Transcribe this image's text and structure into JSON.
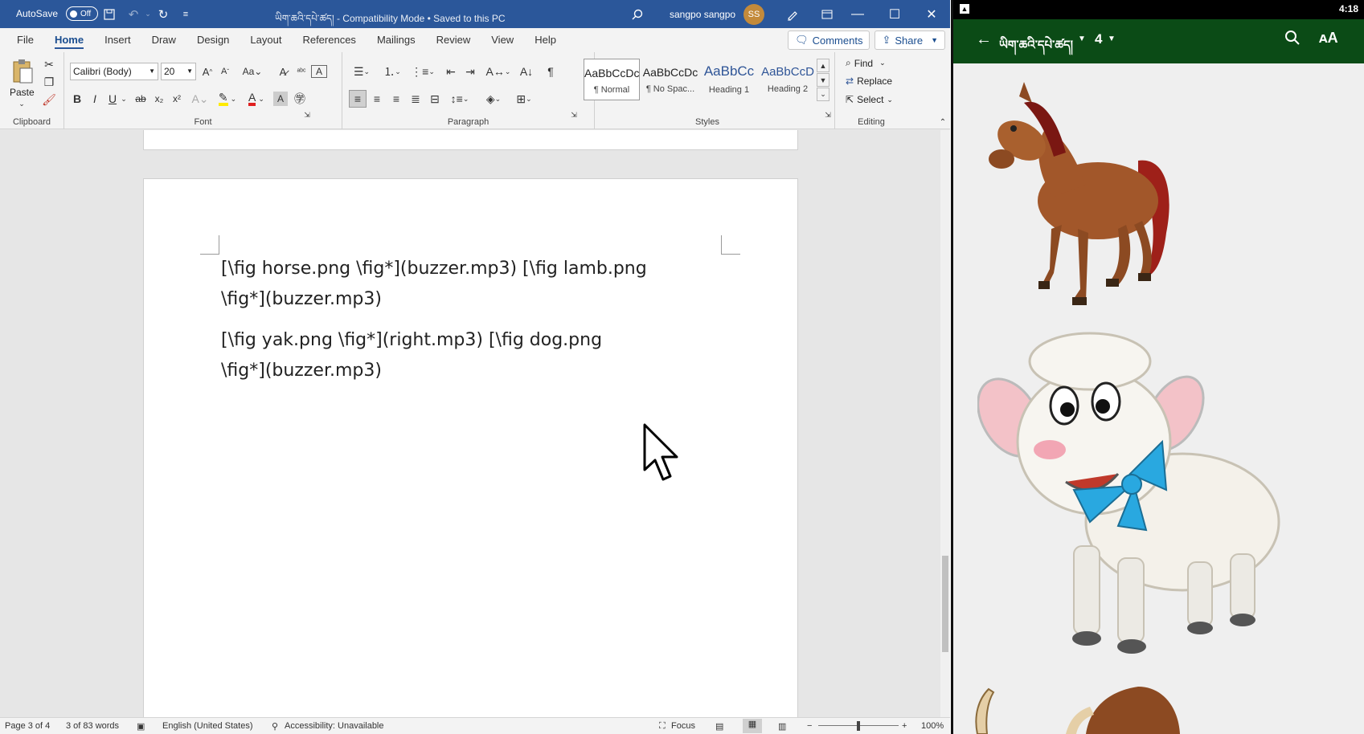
{
  "word": {
    "titlebar": {
      "autosave_label": "AutoSave",
      "autosave_state": "Off",
      "title": "ཡིག་ཆའི་དཔེ་ཚད། - Compatibility Mode • Saved to this PC",
      "user_name": "sangpo sangpo",
      "user_initials": "SS"
    },
    "tabs": [
      "File",
      "Home",
      "Insert",
      "Draw",
      "Design",
      "Layout",
      "References",
      "Mailings",
      "Review",
      "View",
      "Help"
    ],
    "active_tab": "Home",
    "comments_label": "Comments",
    "share_label": "Share",
    "ribbon": {
      "clipboard": {
        "paste": "Paste",
        "label": "Clipboard"
      },
      "font": {
        "name": "Calibri (Body)",
        "size": "20",
        "label": "Font"
      },
      "paragraph": {
        "label": "Paragraph"
      },
      "styles": {
        "label": "Styles",
        "items": [
          {
            "preview": "AaBbCcDc",
            "name": "¶ Normal"
          },
          {
            "preview": "AaBbCcDc",
            "name": "¶ No Spac..."
          },
          {
            "preview": "AaBbCc",
            "name": "Heading 1"
          },
          {
            "preview": "AaBbCcD",
            "name": "Heading 2"
          }
        ]
      },
      "editing": {
        "find": "Find",
        "replace": "Replace",
        "select": "Select",
        "label": "Editing"
      }
    },
    "document": {
      "para1_line1": "[\\fig horse.png \\fig*](buzzer.mp3) [\\fig lamb.png",
      "para1_line2": "\\fig*](buzzer.mp3)",
      "para2_line1": "[\\fig yak.png \\fig*](right.mp3) [\\fig dog.png",
      "para2_line2": "\\fig*](buzzer.mp3)"
    },
    "status": {
      "page": "Page 3 of 4",
      "words": "3 of 83 words",
      "language": "English (United States)",
      "accessibility": "Accessibility: Unavailable",
      "focus": "Focus",
      "zoom": "100%"
    }
  },
  "reader": {
    "status": {
      "time": "4:18"
    },
    "toolbar": {
      "title": "ཡིག་ཆའི་དཔེ་ཚད།",
      "chapter": "4"
    }
  },
  "colors": {
    "word_blue": "#2b579a",
    "reader_green": "#0b4b16"
  }
}
